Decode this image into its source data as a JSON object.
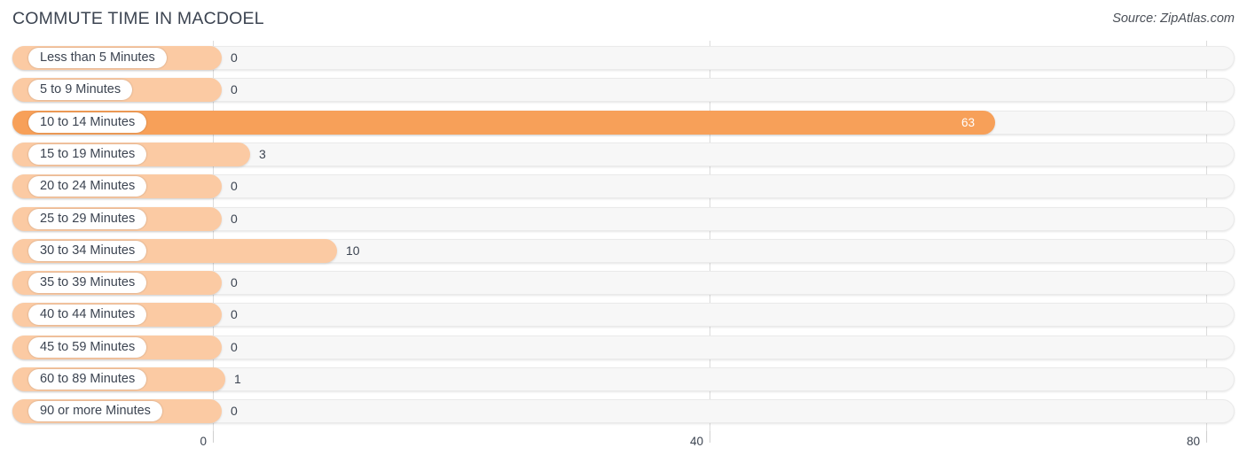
{
  "header": {
    "title": "COMMUTE TIME IN MACDOEL",
    "source": "Source: ZipAtlas.com"
  },
  "colors": {
    "bar_light": "#FBCAA3",
    "bar_dark": "#F7A059",
    "track": "#F7F7F7",
    "gridline": "#DCDCDC",
    "text": "#3C4451"
  },
  "chart_data": {
    "type": "bar",
    "orientation": "horizontal",
    "title": "COMMUTE TIME IN MACDOEL",
    "xlabel": "",
    "ylabel": "",
    "xlim": [
      0,
      80
    ],
    "xticks": [
      0,
      40,
      80
    ],
    "xtick_labels": [
      "0",
      "40",
      "80"
    ],
    "grid": true,
    "legend": "none",
    "categories": [
      "Less than 5 Minutes",
      "5 to 9 Minutes",
      "10 to 14 Minutes",
      "15 to 19 Minutes",
      "20 to 24 Minutes",
      "25 to 29 Minutes",
      "30 to 34 Minutes",
      "35 to 39 Minutes",
      "40 to 44 Minutes",
      "45 to 59 Minutes",
      "60 to 89 Minutes",
      "90 or more Minutes"
    ],
    "values": [
      0,
      0,
      63,
      3,
      0,
      0,
      10,
      0,
      0,
      0,
      1,
      0
    ],
    "value_labels": [
      "0",
      "0",
      "63",
      "3",
      "0",
      "0",
      "10",
      "0",
      "0",
      "0",
      "1",
      "0"
    ],
    "highlight_index": 2
  }
}
